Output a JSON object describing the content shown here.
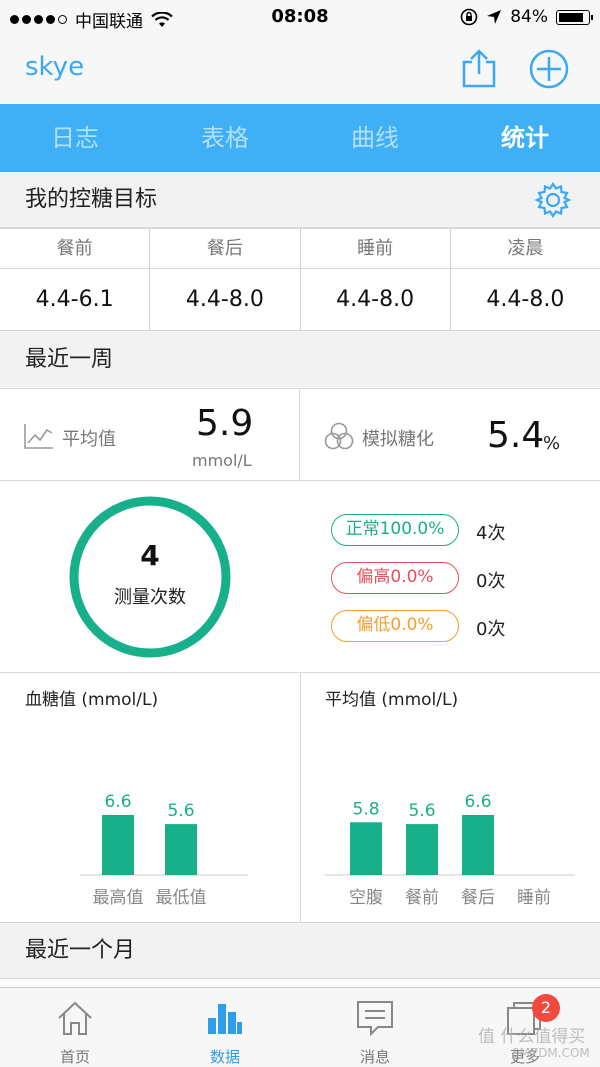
{
  "status_bar": {
    "carrier": "中国联通",
    "time": "08:08",
    "battery": "84%"
  },
  "nav": {
    "title": "skye"
  },
  "tabs": [
    {
      "label": "日志",
      "active": false
    },
    {
      "label": "表格",
      "active": false
    },
    {
      "label": "曲线",
      "active": false
    },
    {
      "label": "统计",
      "active": true
    }
  ],
  "goals": {
    "title": "我的控糖目标",
    "headers": [
      "餐前",
      "餐后",
      "睡前",
      "凌晨"
    ],
    "values": [
      "4.4-6.1",
      "4.4-8.0",
      "4.4-8.0",
      "4.4-8.0"
    ]
  },
  "week": {
    "title": "最近一周",
    "average": {
      "label": "平均值",
      "value": "5.9",
      "unit": "mmol/L"
    },
    "hba1c": {
      "label": "模拟糖化",
      "value": "5.4",
      "unit": "%"
    },
    "count": {
      "value": "4",
      "label": "测量次数"
    },
    "stats": [
      {
        "label": "正常100.0%",
        "count": "4次",
        "color": "#18b08a"
      },
      {
        "label": "偏高0.0%",
        "count": "0次",
        "color": "#e8505b"
      },
      {
        "label": "偏低0.0%",
        "count": "0次",
        "color": "#f5a02a"
      }
    ]
  },
  "month": {
    "title": "最近一个月"
  },
  "tabbar": [
    {
      "label": "首页",
      "icon": "home-icon",
      "active": false
    },
    {
      "label": "数据",
      "icon": "bar-chart-icon",
      "active": true
    },
    {
      "label": "消息",
      "icon": "message-icon",
      "active": false
    },
    {
      "label": "更多",
      "icon": "more-icon",
      "active": false,
      "badge": "2"
    }
  ],
  "watermark": {
    "line1": "值 什么值得买",
    "line2": "SMZDM.COM"
  },
  "chart_data": [
    {
      "type": "bar",
      "title": "血糖值 (mmol/L)",
      "categories": [
        "最高值",
        "最低值"
      ],
      "values": [
        6.6,
        5.6
      ],
      "color": "#18b08a"
    },
    {
      "type": "bar",
      "title": "平均值 (mmol/L)",
      "categories": [
        "空腹",
        "餐前",
        "餐后",
        "睡前"
      ],
      "values": [
        5.8,
        5.6,
        6.6,
        null
      ],
      "color": "#18b08a"
    }
  ]
}
